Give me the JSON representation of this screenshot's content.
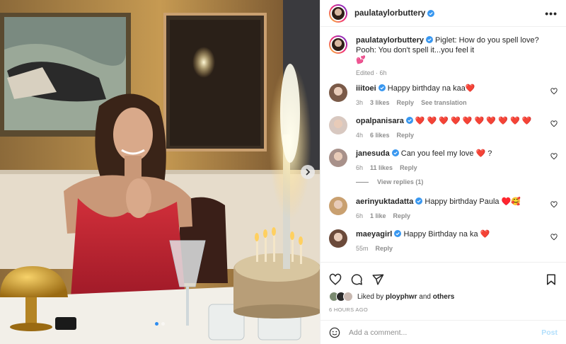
{
  "post": {
    "author": "paulataylorbuttery",
    "caption": "Piglet: How do you spell love?\nPooh: You don't spell it...you feel it\n💕",
    "caption_meta": "Edited · 6h",
    "likes_prefix": "Liked by",
    "liked_by": "ployphwr",
    "likes_and": "and",
    "likes_others": "others",
    "timestamp": "6 HOURS AGO",
    "carousel_dots": 2,
    "carousel_active": 0
  },
  "comments": [
    {
      "user": "iiitoei",
      "text": "Happy birthday na kaa❤️",
      "time": "3h",
      "likes": "3 likes",
      "reply": "Reply",
      "extra": "See translation",
      "avatar_color": "#7a5a48"
    },
    {
      "user": "opalpanisara",
      "text": "❤️ ❤️ ❤️ ❤️ ❤️ ❤️ ❤️ ❤️ ❤️ ❤️",
      "time": "4h",
      "likes": "6 likes",
      "reply": "Reply",
      "extra": "",
      "avatar_color": "#d8c8c0"
    },
    {
      "user": "janesuda",
      "text": "Can you feel my love ❤️ ?",
      "time": "6h",
      "likes": "11 likes",
      "reply": "Reply",
      "extra": "",
      "avatar_color": "#a8918a",
      "view_replies": "View replies (1)"
    },
    {
      "user": "aerinyuktadatta",
      "text": "Happy birthday Paula ♥️🥰",
      "time": "6h",
      "likes": "1 like",
      "reply": "Reply",
      "extra": "",
      "avatar_color": "#c9a070"
    },
    {
      "user": "maeyagirl",
      "text": "Happy Birthday na ka ❤️",
      "time": "55m",
      "likes": "",
      "reply": "Reply",
      "extra": "",
      "avatar_color": "#6b4a3a"
    }
  ],
  "comment_box": {
    "placeholder": "Add a comment...",
    "post_label": "Post"
  },
  "colors": {
    "verified": "#3897f0",
    "post_button": "#b2dffc",
    "muted": "#8e8e8e"
  },
  "icons": [
    "heart-icon",
    "comment-icon",
    "share-icon",
    "bookmark-icon",
    "emoji-icon",
    "more-icon",
    "verified-icon",
    "chevron-right-icon"
  ]
}
